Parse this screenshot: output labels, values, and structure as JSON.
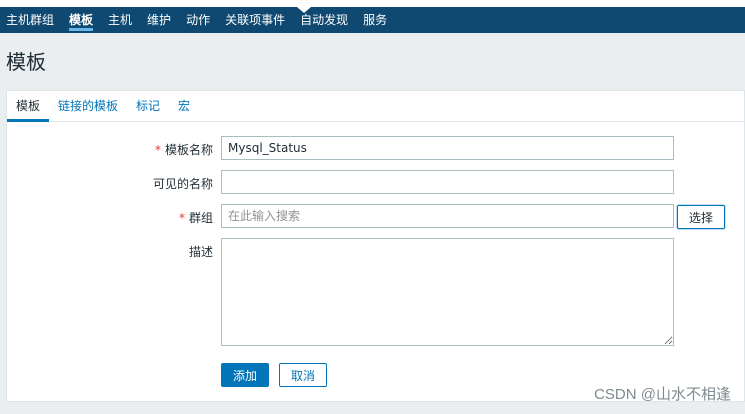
{
  "nav": {
    "items": [
      "主机群组",
      "模板",
      "主机",
      "维护",
      "动作",
      "关联项事件",
      "自动发现",
      "服务"
    ],
    "active_index": 1
  },
  "page": {
    "title": "模板"
  },
  "tabs": [
    "模板",
    "链接的模板",
    "标记",
    "宏"
  ],
  "form": {
    "name_label": "模板名称",
    "name_value": "Mysql_Status",
    "visible_name_label": "可见的名称",
    "visible_name_value": "",
    "group_label": "群组",
    "group_placeholder": "在此输入搜索",
    "select_button": "选择",
    "description_label": "描述",
    "description_value": "",
    "required_mark": "*"
  },
  "actions": {
    "add": "添加",
    "cancel": "取消"
  },
  "watermark": "CSDN @山水不相逢",
  "colors": {
    "nav_bg": "#0f4870",
    "accent": "#0275b8",
    "required": "#e33734"
  }
}
